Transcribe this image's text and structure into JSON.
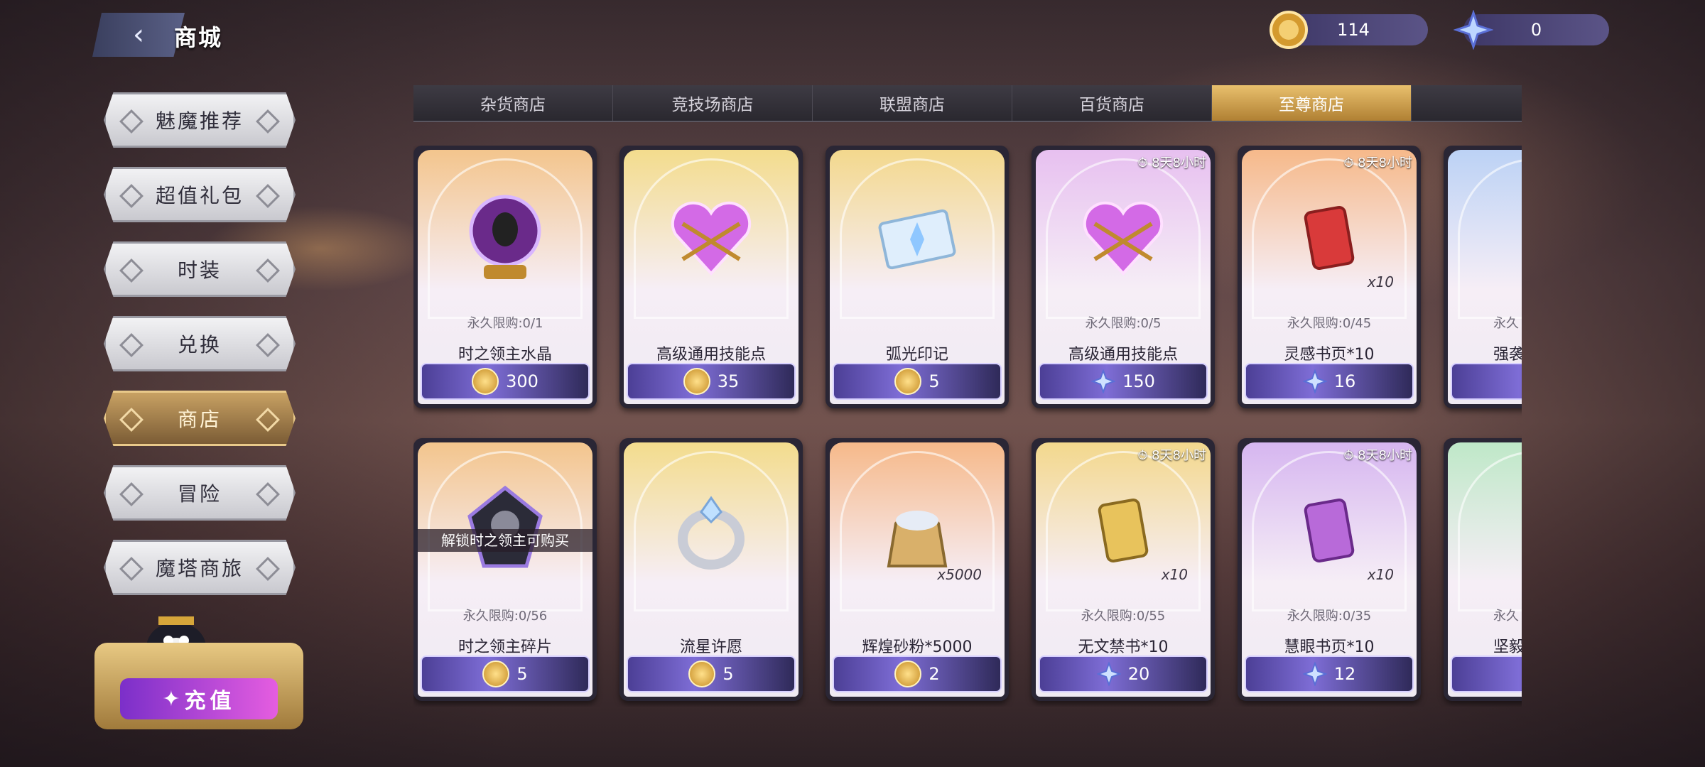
{
  "header": {
    "title": "商城"
  },
  "currencies": {
    "gold": "114",
    "star": "0"
  },
  "sidebar": {
    "items": [
      {
        "label": "魅魔推荐"
      },
      {
        "label": "超值礼包"
      },
      {
        "label": "时装"
      },
      {
        "label": "兑换"
      },
      {
        "label": "商店"
      },
      {
        "label": "冒险"
      },
      {
        "label": "魔塔商旅"
      }
    ],
    "recharge_label": "充值"
  },
  "tabs": [
    "杂货商店",
    "竞技场商店",
    "联盟商店",
    "百货商店",
    "至尊商店"
  ],
  "cards_row1": [
    {
      "limit": "永久限购:0/1",
      "name": "时之领主水晶",
      "price": "300",
      "timer": "",
      "qty": ""
    },
    {
      "limit": "",
      "name": "高级通用技能点",
      "price": "35",
      "timer": "",
      "qty": ""
    },
    {
      "limit": "",
      "name": "弧光印记",
      "price": "5",
      "timer": "",
      "qty": ""
    },
    {
      "limit": "永久限购:0/5",
      "name": "高级通用技能点",
      "price": "150",
      "timer": "8天8小时",
      "qty": ""
    },
    {
      "limit": "永久限购:0/45",
      "name": "灵感书页*10",
      "price": "16",
      "timer": "8天8小时",
      "qty": "x10"
    },
    {
      "limit": "永久",
      "name": "强袭",
      "price": "",
      "timer": "",
      "qty": ""
    }
  ],
  "cards_row2": [
    {
      "limit": "永久限购:0/56",
      "name": "时之领主碎片",
      "price": "5",
      "timer": "",
      "qty": "",
      "banner": "解锁时之领主可购买"
    },
    {
      "limit": "",
      "name": "流星许愿",
      "price": "5",
      "timer": "",
      "qty": ""
    },
    {
      "limit": "",
      "name": "辉煌砂粉*5000",
      "price": "2",
      "timer": "",
      "qty": "x5000"
    },
    {
      "limit": "永久限购:0/55",
      "name": "无文禁书*10",
      "price": "20",
      "timer": "8天8小时",
      "qty": "x10"
    },
    {
      "limit": "永久限购:0/35",
      "name": "慧眼书页*10",
      "price": "12",
      "timer": "8天8小时",
      "qty": "x10"
    },
    {
      "limit": "永久",
      "name": "坚毅",
      "price": "",
      "timer": "",
      "qty": ""
    }
  ]
}
